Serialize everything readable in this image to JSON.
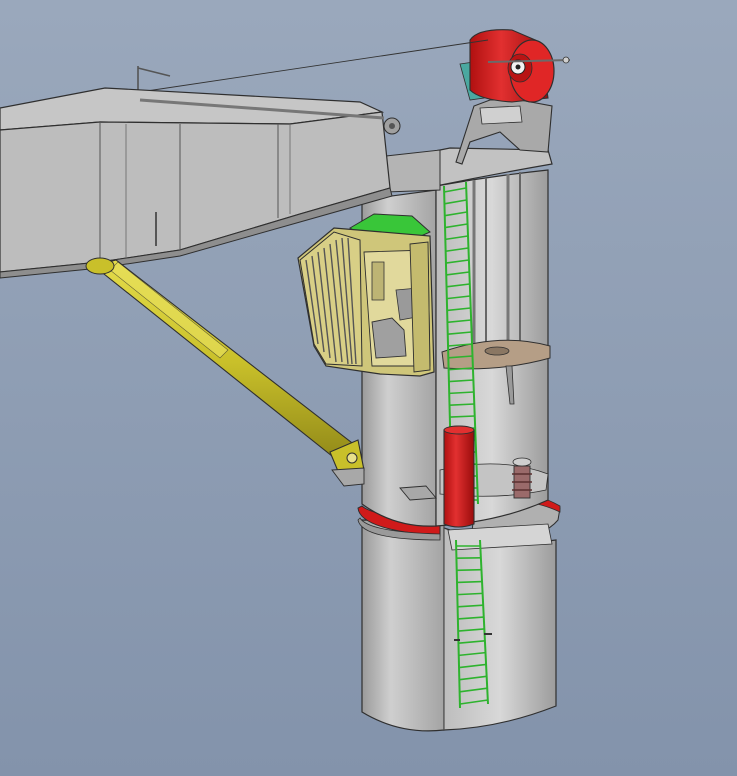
{
  "view": {
    "background_top": "#9aa8bc",
    "background_bottom": "#8393ab"
  },
  "colors": {
    "steel_light": "#c9c9c9",
    "steel_mid": "#b0b0b0",
    "steel_dark": "#8e8e8e",
    "outline": "#2f2f2f",
    "cylinder": "#c9c02a",
    "cylinder_dark": "#8f8718",
    "cabin": "#cfc67a",
    "cabin_roof": "#39c639",
    "accent_red": "#d01a1a",
    "ladder_green": "#2eb32e",
    "deck_tan": "#b59e86"
  },
  "parts": [
    {
      "id": "jib-boom",
      "icon": "boom-icon"
    },
    {
      "id": "luffing-cylinder",
      "icon": "hydraulic-cylinder-icon"
    },
    {
      "id": "operator-cabin",
      "icon": "cabin-icon"
    },
    {
      "id": "slewing-column",
      "icon": "column-icon"
    },
    {
      "id": "pedestal",
      "icon": "pedestal-icon"
    },
    {
      "id": "winch-drum",
      "icon": "winch-icon"
    },
    {
      "id": "access-ladder",
      "icon": "ladder-icon"
    },
    {
      "id": "slew-bearing",
      "icon": "bearing-icon"
    }
  ]
}
